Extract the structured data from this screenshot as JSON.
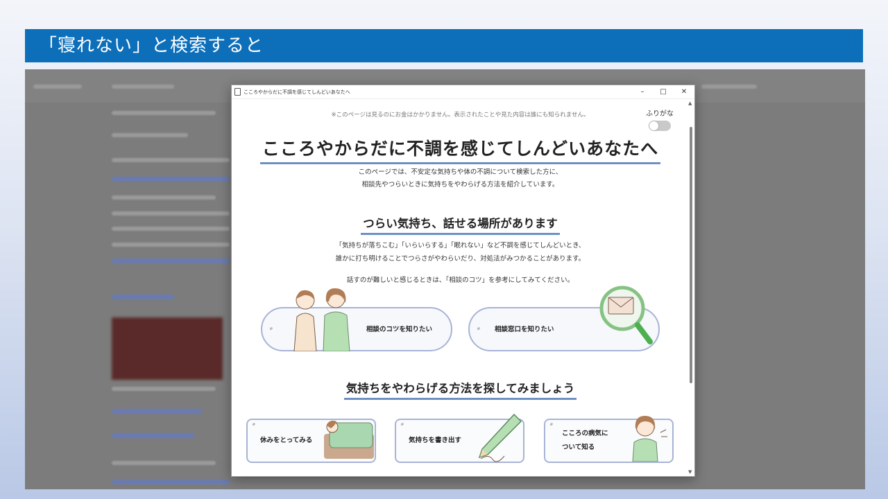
{
  "slide": {
    "title": "「寝れない」と検索すると"
  },
  "popup": {
    "window_title": "こころやからだに不調を感じてしんどいあなたへ",
    "controls": {
      "minimize": "–",
      "maximize": "□",
      "close": "✕"
    },
    "notice": "※このページは見るのにお金はかかりません。表示されたことや見た内容は誰にも知られません。",
    "furigana_label": "ふりがな",
    "furigana_enabled": false,
    "heading": "こころやからだに不調を感じてしんどいあなたへ",
    "intro_lines": [
      "このページでは、不安定な気持ちや体の不調について検索した方に、",
      "相談先やつらいときに気持ちをやわらげる方法を紹介しています。"
    ],
    "section1": {
      "heading": "つらい気持ち、話せる場所があります",
      "lines": [
        "「気持ちが落ちこむ」「いらいらする」「眠れない」など不調を感じてしんどいとき、",
        "誰かに打ち明けることでつらさがやわらいだり、対処法がみつかることがあります。"
      ],
      "note": "話すのが難しいと感じるときは、「相談のコツ」を参考にしてみてください。",
      "buttons": [
        "相談のコツを知りたい",
        "相談窓口を知りたい"
      ]
    },
    "section2": {
      "heading": "気持ちをやわらげる方法を探してみましょう",
      "cards": [
        "休みをとってみる",
        "気持ちを書き出す",
        "こころの病気に",
        "ついて知る"
      ]
    },
    "colors": {
      "accent": "#6e8fc4",
      "title_bar": "#0d6fba",
      "pill_border": "#a8b3d6"
    }
  }
}
